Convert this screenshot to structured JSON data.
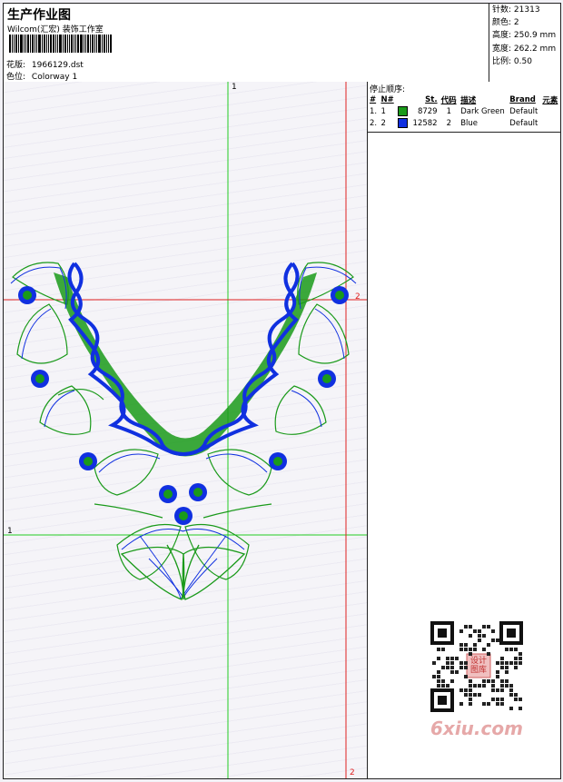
{
  "header": {
    "title": "生产作业图",
    "studio": "Wilcom(汇宏) 装饰工作室",
    "design_label": "花版:",
    "design_value": "1966129.dst",
    "colorway_label": "色位:",
    "colorway_value": "Colorway 1"
  },
  "stats": [
    {
      "label": "针数:",
      "value": "21313"
    },
    {
      "label": "颜色:",
      "value": "2"
    },
    {
      "label": "高度:",
      "value": "250.9 mm"
    },
    {
      "label": "宽度:",
      "value": "262.2 mm"
    },
    {
      "label": "比例:",
      "value": "0.50"
    }
  ],
  "sequence": {
    "heading": "停止顺序:",
    "columns": [
      "#",
      "N#",
      "St.",
      "代码",
      "描述",
      "Brand",
      "元素"
    ],
    "rows": [
      {
        "num": "1.",
        "n": "1",
        "color": "#1a9a1a",
        "stitches": "8729",
        "code": "1",
        "desc": "Dark Green",
        "brand": "Default",
        "element": ""
      },
      {
        "num": "2.",
        "n": "2",
        "color": "#1030e0",
        "stitches": "12582",
        "code": "2",
        "desc": "Blue",
        "brand": "Default",
        "element": ""
      }
    ]
  },
  "guides": {
    "green_v": "1",
    "green_h": "1",
    "red_v": "2",
    "red_h": "2"
  },
  "watermark": "6xiu.com",
  "qr_stamp": "设计图库",
  "colors": {
    "green": "#1a9a1a",
    "blue": "#1030e0",
    "guide_green": "#22cc22",
    "guide_red": "#e02020"
  }
}
